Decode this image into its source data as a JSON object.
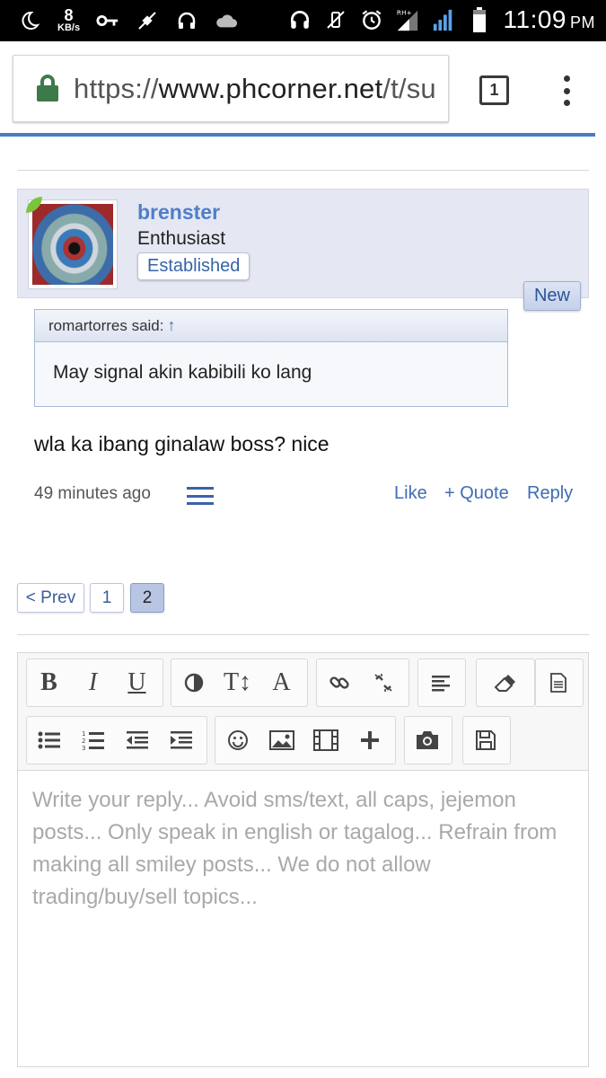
{
  "status_bar": {
    "speed_value": "8",
    "speed_unit": "KB/s",
    "time": "11:09",
    "ampm": "PM"
  },
  "browser": {
    "url_scheme": "https://",
    "url_host": "www.phcorner.net",
    "url_path": "/t/su",
    "tab_count": "1"
  },
  "post": {
    "username": "brenster",
    "user_title": "Enthusiast",
    "user_badge": "Established",
    "new_tag": "New",
    "quote_author": "romartorres said:",
    "quote_arrow": "↑",
    "quote_text": "May signal akin kabibili ko lang",
    "message": "wla ka ibang ginalaw boss? nice",
    "time_ago": "49 minutes ago",
    "actions": {
      "like": "Like",
      "quote": "+ Quote",
      "reply": "Reply"
    }
  },
  "pagination": {
    "prev": "< Prev",
    "pages": [
      "1",
      "2"
    ],
    "current": "2"
  },
  "editor": {
    "toolbar_icons": [
      "bold-icon",
      "italic-icon",
      "underline-icon",
      "contrast-icon",
      "text-size-icon",
      "font-icon",
      "link-icon",
      "unlink-icon",
      "align-icon",
      "eraser-icon",
      "source-icon",
      "bullet-list-icon",
      "numbered-list-icon",
      "outdent-icon",
      "indent-icon",
      "smiley-icon",
      "image-icon",
      "media-icon",
      "insert-icon",
      "camera-icon",
      "save-draft-icon"
    ],
    "placeholder": "Write your reply... Avoid sms/text, all caps, jejemon posts... Only speak in english or tagalog... Refrain from making all smiley posts... We do not allow trading/buy/sell topics..."
  },
  "colors": {
    "accent": "#3d6db3",
    "username": "#4f7ec9",
    "online": "#7cc43c",
    "lock": "#3d7a4a"
  }
}
